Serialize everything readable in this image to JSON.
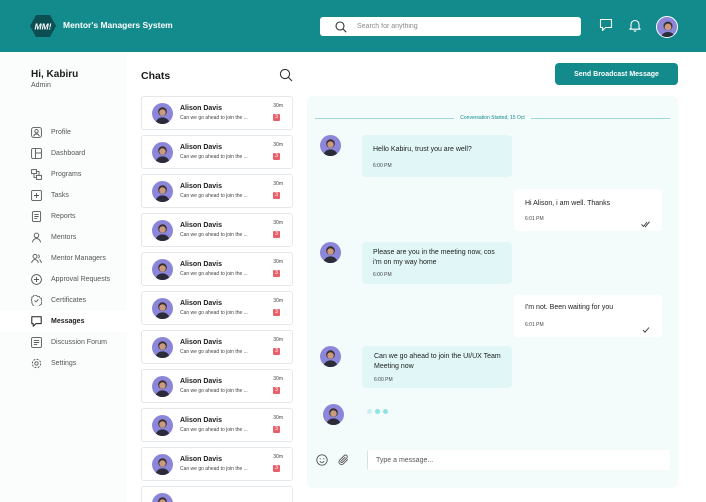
{
  "app": {
    "logo_text": "MM!",
    "title": "Mentor's Managers System",
    "colors": {
      "brand": "#138a8c",
      "badge": "#e8616a",
      "bubble_in": "#e1f7f7",
      "panel_bg": "#f4fbfb"
    }
  },
  "header": {
    "search_placeholder": "Search for anything",
    "icons": [
      "search-icon",
      "message-icon",
      "bell-icon",
      "user-avatar"
    ]
  },
  "sidebar": {
    "greeting": "Hi, Kabiru",
    "role": "Admin",
    "items": [
      {
        "label": "Profile",
        "icon": "profile-icon"
      },
      {
        "label": "Dashboard",
        "icon": "dashboard-icon"
      },
      {
        "label": "Programs",
        "icon": "programs-icon"
      },
      {
        "label": "Tasks",
        "icon": "tasks-icon"
      },
      {
        "label": "Reports",
        "icon": "reports-icon"
      },
      {
        "label": "Mentors",
        "icon": "mentors-icon"
      },
      {
        "label": "Mentor Managers",
        "icon": "mentor-managers-icon"
      },
      {
        "label": "Approval Requests",
        "icon": "approval-icon"
      },
      {
        "label": "Certificates",
        "icon": "certificate-icon"
      },
      {
        "label": "Messages",
        "icon": "messages-icon",
        "active": true
      },
      {
        "label": "Discussion Forum",
        "icon": "forum-icon"
      },
      {
        "label": "Settings",
        "icon": "settings-icon"
      }
    ]
  },
  "chats": {
    "title": "Chats",
    "items": [
      {
        "name": "Alison Davis",
        "preview": "Can we go ahead to join the ...",
        "time": "30m",
        "badge": "3"
      },
      {
        "name": "Alison Davis",
        "preview": "Can we go ahead to join the ...",
        "time": "30m",
        "badge": "3"
      },
      {
        "name": "Alison Davis",
        "preview": "Can we go ahead to join the ...",
        "time": "30m",
        "badge": "3"
      },
      {
        "name": "Alison Davis",
        "preview": "Can we go ahead to join the ...",
        "time": "30m",
        "badge": "3"
      },
      {
        "name": "Alison Davis",
        "preview": "Can we go ahead to join the ...",
        "time": "30m",
        "badge": "3"
      },
      {
        "name": "Alison Davis",
        "preview": "Can we go ahead to join the ...",
        "time": "30m",
        "badge": "3"
      },
      {
        "name": "Alison Davis",
        "preview": "Can we go ahead to join the ...",
        "time": "30m",
        "badge": "3"
      },
      {
        "name": "Alison Davis",
        "preview": "Can we go ahead to join the ...",
        "time": "30m",
        "badge": "3"
      },
      {
        "name": "Alison Davis",
        "preview": "Can we go ahead to join the ...",
        "time": "30m",
        "badge": "3"
      },
      {
        "name": "Alison Davis",
        "preview": "Can we go ahead to join the ...",
        "time": "30m",
        "badge": "3"
      },
      {
        "name": "",
        "preview": "",
        "time": "",
        "badge": ""
      }
    ]
  },
  "conversation": {
    "broadcast_label": "Send Broadcast Message",
    "started_label": "Conversation Started,  15 Oct",
    "messages": [
      {
        "dir": "in",
        "text": "Hello Kabiru, trust you are well?",
        "time": "6:00 PM"
      },
      {
        "dir": "out",
        "text": "Hi Alison, i am well. Thanks",
        "time": "6:01 PM",
        "status": "double-check-icon"
      },
      {
        "dir": "in",
        "text": "Please are you in the meeting now, cos i'm on my way home",
        "time": "6:00 PM"
      },
      {
        "dir": "out",
        "text": "I'm not. Been waiting for you",
        "time": "6:01 PM",
        "status": "check-icon"
      },
      {
        "dir": "in",
        "text": "Can we go ahead to join the UI/UX Team Meeting now",
        "time": "6:00 PM"
      }
    ],
    "composer_placeholder": "Type a message..."
  }
}
